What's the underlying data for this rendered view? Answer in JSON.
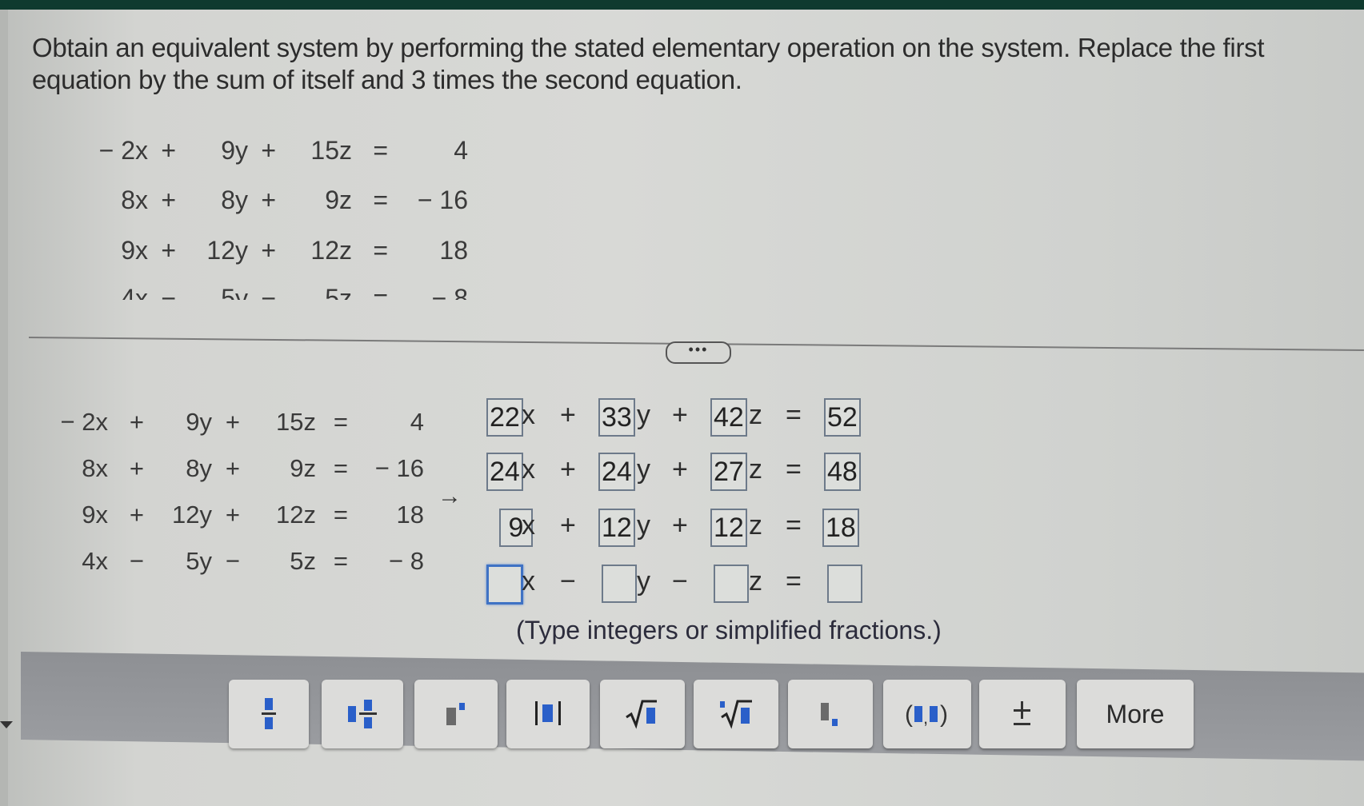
{
  "prompt": "Obtain an equivalent system by performing the stated elementary operation on the system. Replace the first equation by the sum of itself and 3 times the second equation.",
  "original_system": [
    {
      "x": "− 2x",
      "op1": "+",
      "y": "9y",
      "op2": "+",
      "z": "15z",
      "eq": "=",
      "rhs": "4"
    },
    {
      "x": "8x",
      "op1": "+",
      "y": "8y",
      "op2": "+",
      "z": "9z",
      "eq": "=",
      "rhs": "− 16"
    },
    {
      "x": "9x",
      "op1": "+",
      "y": "12y",
      "op2": "+",
      "z": "12z",
      "eq": "=",
      "rhs": "18"
    },
    {
      "x": "4x",
      "op1": "−",
      "y": "5y",
      "op2": "−",
      "z": "5z",
      "eq": "=",
      "rhs": "− 8"
    }
  ],
  "expand_button": "•••",
  "arrow": "→",
  "answer_rows": [
    {
      "x": "22",
      "op1": "+",
      "y": "33",
      "op2": "+",
      "z": "42",
      "eq": "=",
      "rhs": "52"
    },
    {
      "x": "24",
      "op1": "+",
      "y": "24",
      "op2": "+",
      "z": "27",
      "eq": "=",
      "rhs": "48"
    },
    {
      "x": "9",
      "op1": "+",
      "y": "12",
      "op2": "+",
      "z": "12",
      "eq": "=",
      "rhs": "18"
    },
    {
      "x": "",
      "op1": "−",
      "y": "",
      "op2": "−",
      "z": "",
      "eq": "=",
      "rhs": ""
    }
  ],
  "vars": {
    "x": "x",
    "y": "y",
    "z": "z"
  },
  "hint": "(Type integers or simplified fractions.)",
  "toolbar": {
    "buttons": [
      {
        "name": "fraction",
        "icon": "fraction-icon"
      },
      {
        "name": "mixed-number",
        "icon": "mixed-number-icon"
      },
      {
        "name": "exponent",
        "icon": "exponent-icon"
      },
      {
        "name": "absolute-value",
        "icon": "absolute-value-icon"
      },
      {
        "name": "square-root",
        "icon": "square-root-icon"
      },
      {
        "name": "nth-root",
        "icon": "nth-root-icon"
      },
      {
        "name": "subscript",
        "icon": "subscript-icon"
      },
      {
        "name": "ordered-pair",
        "icon": "ordered-pair-icon"
      },
      {
        "name": "plus-minus",
        "icon": "plus-minus-icon"
      }
    ],
    "more_label": "More"
  },
  "colors": {
    "accent": "#2a5fc9",
    "box_border": "#6d7a8a",
    "active_border": "#3f72c4"
  }
}
